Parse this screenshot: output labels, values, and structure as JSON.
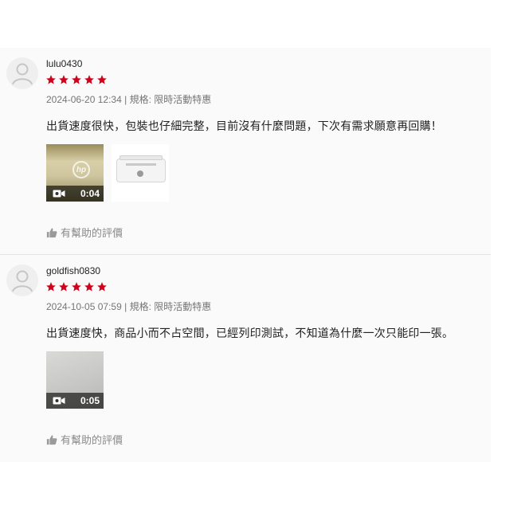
{
  "colors": {
    "star": "#d0011b",
    "meta_text": "#757575",
    "helpful_text": "#8a8a8a",
    "panel_bg": "#fafafa"
  },
  "reviews": [
    {
      "username": "lulu0430",
      "rating": 5,
      "date": "2024-06-20 12:34",
      "separator": "|",
      "variation_label": "規格:",
      "variation": "限時活動特惠",
      "comment": "出貨速度很快，包裝也仔細完整，目前沒有什麼問題，下次有需求願意再回購！",
      "media": [
        {
          "type": "video",
          "duration": "0:04",
          "icon": "video-camera-icon"
        },
        {
          "type": "image",
          "icon": "printer-photo"
        }
      ],
      "helpful_label": "有幫助的評價",
      "helpful_icon": "thumbs-up-icon"
    },
    {
      "username": "goldfish0830",
      "rating": 5,
      "date": "2024-10-05 07:59",
      "separator": "|",
      "variation_label": "規格:",
      "variation": "限時活動特惠",
      "comment": "出貨速度快，商品小而不占空間，已經列印測試，不知道為什麼一次只能印一張。",
      "media": [
        {
          "type": "video",
          "duration": "0:05",
          "icon": "video-camera-icon"
        }
      ],
      "helpful_label": "有幫助的評價",
      "helpful_icon": "thumbs-up-icon"
    }
  ]
}
